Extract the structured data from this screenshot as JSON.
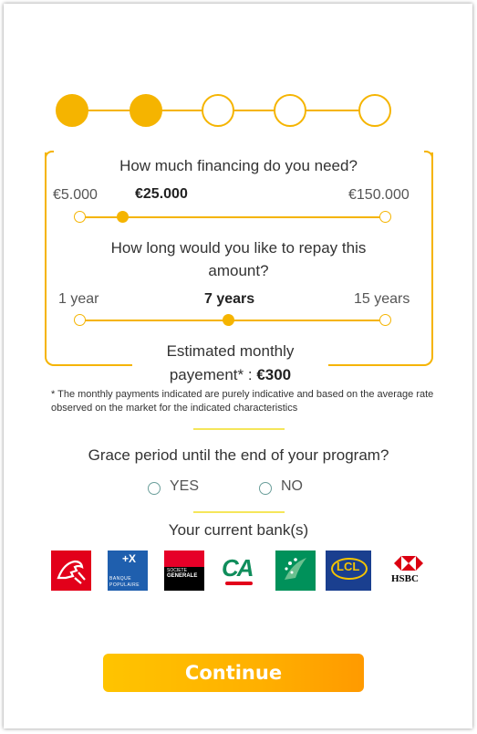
{
  "financing": {
    "question": "How much financing do you need?",
    "min_label": "€5.000",
    "value_label": "€25.000",
    "max_label": "€150.000",
    "value_fraction": 0.138
  },
  "duration": {
    "question_line1": "How long would you like to repay this",
    "question_line2": "amount?",
    "min_label": "1 year",
    "value_label": "7 years",
    "max_label": "15 years",
    "value_fraction": 0.487
  },
  "estimate": {
    "label_line1": "Estimated monthly",
    "label_line2": "payement* :",
    "value": "€300"
  },
  "note": "* The monthly payments indicated are purely indicative and based on the average rate observed on the market for the indicated characteristics",
  "grace": {
    "question": "Grace period until the end of your program?",
    "yes_label": "YES",
    "no_label": "NO"
  },
  "banks": {
    "title": "Your current bank(s)",
    "hsbc_label": "HSBC",
    "bp_label_1": "BANQUE",
    "bp_label_2": "POPULAIRE",
    "sg_label_1": "SOCIETE",
    "sg_label_2": "GENERALE",
    "lcl_label": "LCL",
    "ca_label": "CA",
    "bp_mark": "+X"
  },
  "continue_label": "Continue",
  "colors": {
    "accent": "#f5b400",
    "separator": "#f5e65a",
    "radio": "#6a9e9a"
  }
}
